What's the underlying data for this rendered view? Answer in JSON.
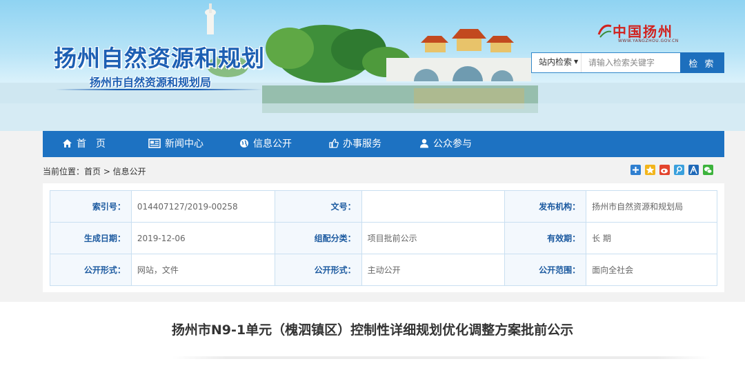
{
  "header": {
    "site_title": "扬州自然资源和规划",
    "site_subtitle": "扬州市自然资源和规划局",
    "portal_logo_text": "中国扬州",
    "portal_logo_url": "WWW.YANGZHOU.GOV.CN"
  },
  "search": {
    "scope_label": "站内检索",
    "placeholder": "请输入检索关键字",
    "button_label": "检 索"
  },
  "nav": {
    "items": [
      {
        "label": "首　页",
        "icon": "home-icon"
      },
      {
        "label": "新闻中心",
        "icon": "newspaper-icon"
      },
      {
        "label": "信息公开",
        "icon": "globe-icon"
      },
      {
        "label": "办事服务",
        "icon": "thumbs-up-icon"
      },
      {
        "label": "公众参与",
        "icon": "user-icon"
      }
    ]
  },
  "breadcrumb": "当前位置：首页 > 信息公开",
  "share_icons": [
    "share-plus-icon",
    "qzone-icon",
    "weibo-icon",
    "tencent-weibo-icon",
    "renren-icon",
    "wechat-icon"
  ],
  "info": {
    "rows": [
      [
        {
          "label": "索引号：",
          "value": "014407127/2019-00258"
        },
        {
          "label": "文号：",
          "value": ""
        },
        {
          "label": "发布机构：",
          "value": "扬州市自然资源和规划局"
        }
      ],
      [
        {
          "label": "生成日期：",
          "value": "2019-12-06"
        },
        {
          "label": "组配分类：",
          "value": "项目批前公示"
        },
        {
          "label": "有效期：",
          "value": "长 期"
        }
      ],
      [
        {
          "label": "公开形式：",
          "value": "网站，文件"
        },
        {
          "label": "公开形式：",
          "value": "主动公开"
        },
        {
          "label": "公开范围：",
          "value": "面向全社会"
        }
      ]
    ]
  },
  "article": {
    "title": "扬州市N9-1单元（槐泗镇区）控制性详细规划优化调整方案批前公示"
  },
  "colors": {
    "brand_blue": "#1d72c2",
    "title_blue": "#1d5fb3",
    "logo_red": "#d1221e"
  }
}
